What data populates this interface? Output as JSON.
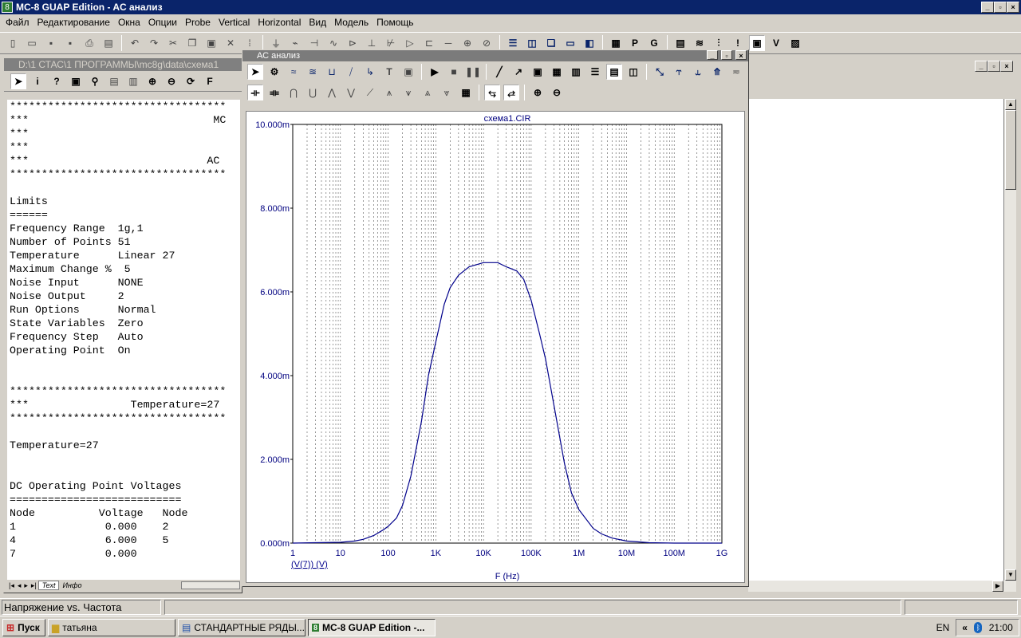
{
  "app": {
    "title": "MC-8 GUAP Edition - AC анализ",
    "icon_glyph": "8"
  },
  "menu": [
    "Файл",
    "Редактирование",
    "Окна",
    "Опции",
    "Probe",
    "Vertical",
    "Horizontal",
    "Вид",
    "Модель",
    "Помощь"
  ],
  "text_window": {
    "title": "D:\\1 СТАС\\1 ПРОГРАММЫ\\mc8g\\data\\схема1",
    "lines": [
      "**********************************",
      "***                             MC",
      "***",
      "***",
      "***                            AC",
      "**********************************",
      "",
      "Limits",
      "======",
      "Frequency Range  1g,1",
      "Number of Points 51",
      "Temperature      Linear 27",
      "Maximum Change %  5",
      "Noise Input      NONE",
      "Noise Output     2",
      "Run Options      Normal",
      "State Variables  Zero",
      "Frequency Step   Auto",
      "Operating Point  On",
      "",
      "",
      "**********************************",
      "***                Temperature=27",
      "**********************************",
      "",
      "Temperature=27",
      "",
      "",
      "DC Operating Point Voltages",
      "===========================",
      "Node          Voltage   Node",
      "1              0.000    2",
      "4              6.000    5",
      "7              0.000"
    ],
    "tabs": [
      "Text",
      "Инфо"
    ]
  },
  "ac_window": {
    "title": "АС анализ",
    "plot_title": "схема1.CIR",
    "trace_label": "(V(7)) (V)",
    "x_axis_label": "F (Hz)"
  },
  "chart_data": {
    "type": "line",
    "title": "схема1.CIR",
    "xlabel": "F (Hz)",
    "ylabel": "",
    "x_scale": "log",
    "xlim": [
      1,
      1000000000
    ],
    "ylim": [
      0,
      0.01
    ],
    "x_ticks": [
      "1",
      "10",
      "100",
      "1K",
      "10K",
      "100K",
      "1M",
      "10M",
      "100M",
      "1G"
    ],
    "y_ticks": [
      "0.000m",
      "2.000m",
      "4.000m",
      "6.000m",
      "8.000m",
      "10.000m"
    ],
    "grid": true,
    "series": [
      {
        "name": "(V(7)) (V)",
        "color": "#00008b",
        "x": [
          1,
          10,
          20,
          30,
          50,
          80,
          100,
          150,
          200,
          300,
          500,
          700,
          1000,
          1500,
          2000,
          3000,
          5000,
          10000,
          20000,
          30000,
          50000,
          70000,
          100000,
          150000,
          200000,
          300000,
          500000,
          700000,
          1000000,
          2000000,
          3000000,
          5000000,
          10000000,
          30000000,
          100000000,
          1000000000
        ],
        "y": [
          0.0,
          2e-05,
          5e-05,
          9e-05,
          0.00018,
          0.00032,
          0.0004,
          0.0006,
          0.0009,
          0.0016,
          0.0029,
          0.004,
          0.0048,
          0.0057,
          0.0061,
          0.0064,
          0.0066,
          0.0067,
          0.0067,
          0.0066,
          0.0065,
          0.0063,
          0.0058,
          0.005,
          0.0044,
          0.0033,
          0.0019,
          0.0012,
          0.0008,
          0.00035,
          0.00022,
          0.00012,
          5e-05,
          1e-05,
          0.0,
          0.0
        ]
      }
    ]
  },
  "status": {
    "text": "Напряжение vs. Частота"
  },
  "taskbar": {
    "start": "Пуск",
    "items": [
      {
        "label": "татьяна",
        "active": false
      },
      {
        "label": "СТАНДАРТНЫЕ РЯДЫ...",
        "active": false
      },
      {
        "label": "MC-8 GUAP Edition -...",
        "active": true
      }
    ],
    "lang": "EN",
    "clock": "21:00"
  },
  "colors": {
    "titlebar": "#0a246a",
    "trace": "#00008b",
    "grid": "#404040",
    "axis_text": "#000080"
  }
}
